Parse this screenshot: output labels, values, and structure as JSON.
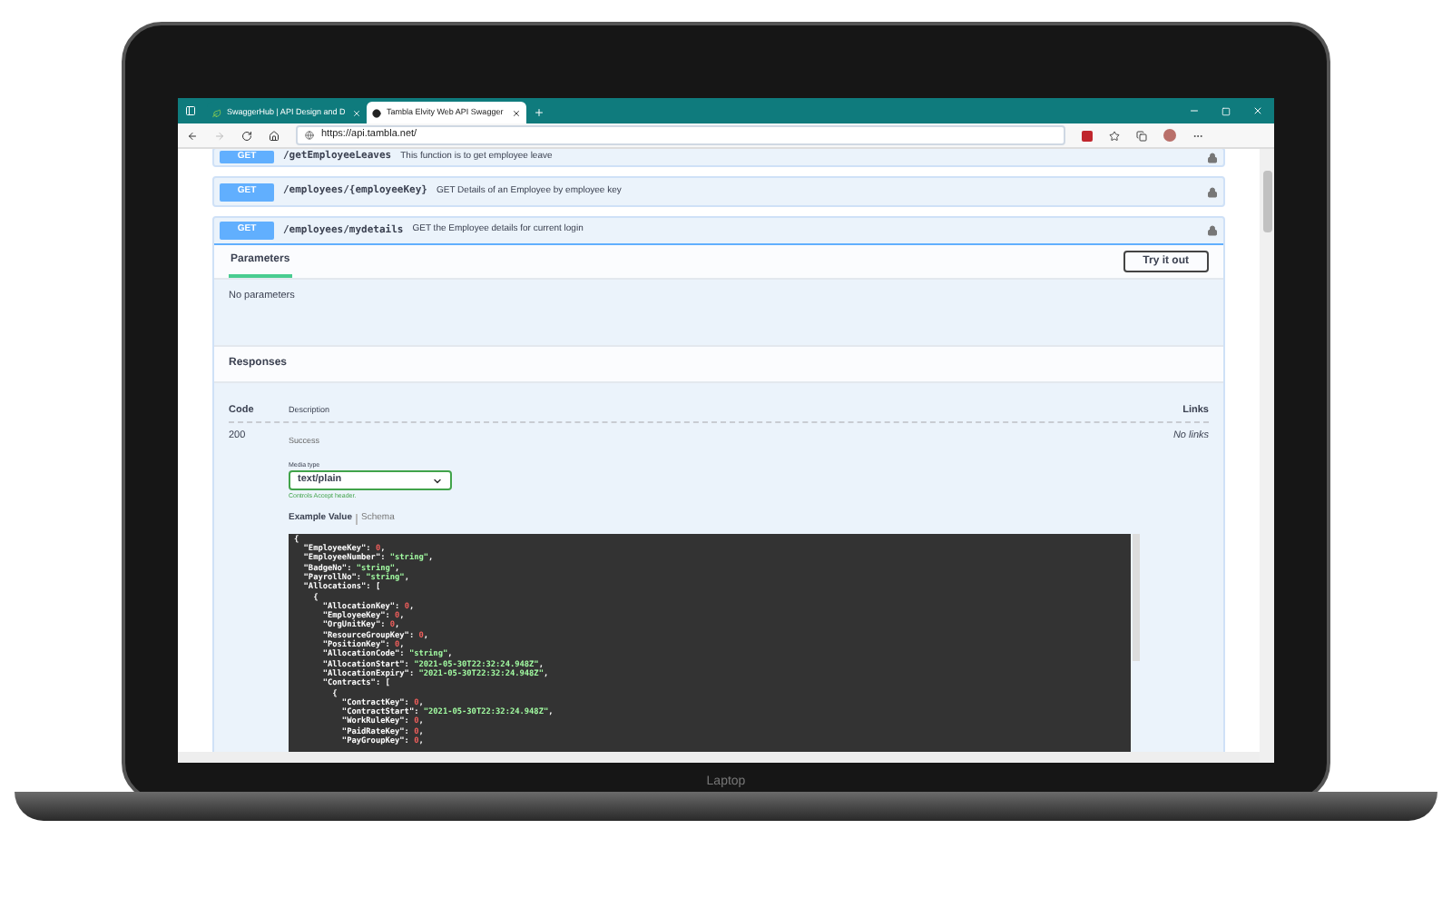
{
  "browser": {
    "tabs": [
      {
        "title": "SwaggerHub | API Design and D",
        "selected": false
      },
      {
        "title": "Tambla Elvity Web API Swagger",
        "selected": true
      }
    ],
    "address": "https://api.tambla.net/"
  },
  "operations": [
    {
      "method": "GET",
      "path": "/getEmployeeLeaves",
      "summary": "This function is to get employee leave",
      "expanded": false
    },
    {
      "method": "GET",
      "path": "/employees/{employeeKey}",
      "summary": "GET Details of an Employee by employee key",
      "expanded": false
    },
    {
      "method": "GET",
      "path": "/employees/mydetails",
      "summary": "GET the Employee details for current login",
      "expanded": true
    }
  ],
  "detail": {
    "tab": "Parameters",
    "try_button": "Try it out",
    "no_params": "No parameters",
    "responses_title": "Responses",
    "columns": [
      "Code",
      "Description",
      "Links"
    ],
    "response": {
      "code": "200",
      "description": "Success",
      "links": "No links",
      "media_label": "Media type",
      "media_value": "text/plain",
      "media_hint": "Controls Accept header.",
      "example_tabs": [
        {
          "label": "Example Value",
          "selected": true
        },
        {
          "label": "Schema",
          "selected": false
        }
      ],
      "code_lines": [
        "{",
        "  \"EmployeeKey\": 0,",
        "  \"EmployeeNumber\": \"string\",",
        "  \"BadgeNo\": \"string\",",
        "  \"PayrollNo\": \"string\",",
        "  \"Allocations\": [",
        "    {",
        "      \"AllocationKey\": 0,",
        "      \"EmployeeKey\": 0,",
        "      \"OrgUnitKey\": 0,",
        "      \"ResourceGroupKey\": 0,",
        "      \"PositionKey\": 0,",
        "      \"AllocationCode\": \"string\",",
        "      \"AllocationStart\": \"2021-05-30T22:32:24.948Z\",",
        "      \"AllocationExpiry\": \"2021-05-30T22:32:24.948Z\",",
        "      \"Contracts\": [",
        "        {",
        "          \"ContractKey\": 0,",
        "          \"ContractStart\": \"2021-05-30T22:32:24.948Z\",",
        "          \"WorkRuleKey\": 0,",
        "          \"PaidRateKey\": 0,",
        "          \"PayGroupKey\": 0,"
      ]
    }
  },
  "laptop_label": "Laptop"
}
